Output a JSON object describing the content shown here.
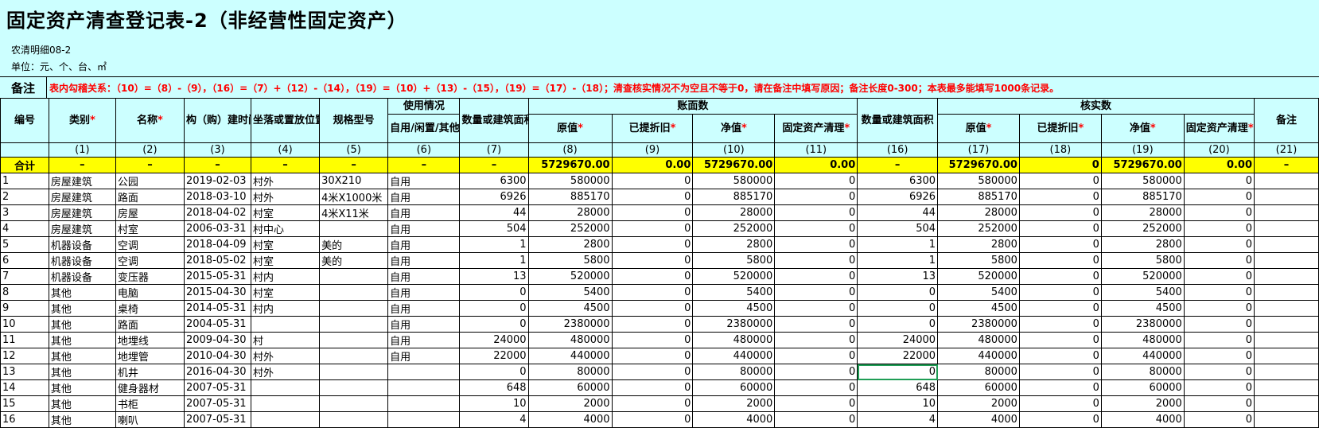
{
  "title": "固定资产清查登记表-2（非经营性固定资产）",
  "subtitle_code": "农清明细08-2",
  "unit_line": "单位：元、个、台、㎡",
  "remark": {
    "label": "备注",
    "text": "表内勾稽关系：（10）=（8）-（9），（16）=（7）+（12）-（14），（19）=（10）+（13）-（15），（19）=（17）-（18）；清查核实情况不为空且不等于0，请在备注中填写原因；备注长度0-300；本表最多能填写1000条记录。"
  },
  "headers": {
    "id": "编号",
    "category": "类别",
    "name": "名称",
    "build_time": "构（购）建时间",
    "location": "坐落或置放位置",
    "spec": "规格型号",
    "usage_group": "使用情况",
    "usage_sub": "自用/闲置/其他",
    "qty_area": "数量或建筑面积",
    "book_group": "账面数",
    "orig_value": "原值",
    "depreciation": "已提折旧",
    "net_value": "净值",
    "fixed_clean": "固定资产清理",
    "verified_group": "核实数",
    "v_qty_area": "数量或建筑面积",
    "v_orig_value": "原值",
    "v_depreciation": "已提折旧",
    "v_net_value": "净值",
    "v_fixed_clean": "固定资产清理",
    "note": "备注",
    "required_mark": "*"
  },
  "col_index": [
    "(1)",
    "(2)",
    "(3)",
    "(4)",
    "(5)",
    "(6)",
    "(7)",
    "(8)",
    "(9)",
    "(10)",
    "(11)",
    "(16)",
    "(17)",
    "(18)",
    "(19)",
    "(20)",
    "(21)"
  ],
  "total": {
    "label": "合计",
    "dash": "–",
    "orig_value": "5729670.00",
    "depreciation": "0.00",
    "net_value": "5729670.00",
    "fixed_clean": "0.00",
    "v_orig_value": "5729670.00",
    "v_depreciation": "0",
    "v_net_value": "5729670.00",
    "v_fixed_clean": "0.00"
  },
  "rows": [
    [
      "1",
      "房屋建筑",
      "公园",
      "2019-02-03",
      "村外",
      "30X210",
      "自用",
      "6300",
      "580000",
      "0",
      "580000",
      "0",
      "6300",
      "580000",
      "0",
      "580000",
      "0",
      ""
    ],
    [
      "2",
      "房屋建筑",
      "路面",
      "2018-03-10",
      "村外",
      "4米X1000米",
      "自用",
      "6926",
      "885170",
      "0",
      "885170",
      "0",
      "6926",
      "885170",
      "0",
      "885170",
      "0",
      ""
    ],
    [
      "3",
      "房屋建筑",
      "房屋",
      "2018-04-02",
      "村室",
      "4米X11米",
      "自用",
      "44",
      "28000",
      "0",
      "28000",
      "0",
      "44",
      "28000",
      "0",
      "28000",
      "0",
      ""
    ],
    [
      "4",
      "房屋建筑",
      "村室",
      "2006-03-31",
      "村中心",
      "",
      "自用",
      "504",
      "252000",
      "0",
      "252000",
      "0",
      "504",
      "252000",
      "0",
      "252000",
      "0",
      ""
    ],
    [
      "5",
      "机器设备",
      "空调",
      "2018-04-09",
      "村室",
      "美的",
      "自用",
      "1",
      "2800",
      "0",
      "2800",
      "0",
      "1",
      "2800",
      "0",
      "2800",
      "0",
      ""
    ],
    [
      "6",
      "机器设备",
      "空调",
      "2018-05-02",
      "村室",
      "美的",
      "自用",
      "1",
      "5800",
      "0",
      "5800",
      "0",
      "1",
      "5800",
      "0",
      "5800",
      "0",
      ""
    ],
    [
      "7",
      "机器设备",
      "变压器",
      "2015-05-31",
      "村内",
      "",
      "自用",
      "13",
      "520000",
      "0",
      "520000",
      "0",
      "13",
      "520000",
      "0",
      "520000",
      "0",
      ""
    ],
    [
      "8",
      "其他",
      "电脑",
      "2015-04-30",
      "村室",
      "",
      "自用",
      "0",
      "5400",
      "0",
      "5400",
      "0",
      "0",
      "5400",
      "0",
      "5400",
      "0",
      ""
    ],
    [
      "9",
      "其他",
      "桌椅",
      "2014-05-31",
      "村内",
      "",
      "自用",
      "0",
      "4500",
      "0",
      "4500",
      "0",
      "0",
      "4500",
      "0",
      "4500",
      "0",
      ""
    ],
    [
      "10",
      "其他",
      "路面",
      "2004-05-31",
      "",
      "",
      "自用",
      "0",
      "2380000",
      "0",
      "2380000",
      "0",
      "0",
      "2380000",
      "0",
      "2380000",
      "0",
      ""
    ],
    [
      "11",
      "其他",
      "地埋线",
      "2009-04-30",
      "村",
      "",
      "自用",
      "24000",
      "480000",
      "0",
      "480000",
      "0",
      "24000",
      "480000",
      "0",
      "480000",
      "0",
      ""
    ],
    [
      "12",
      "其他",
      "地埋管",
      "2010-04-30",
      "村外",
      "",
      "自用",
      "22000",
      "440000",
      "0",
      "440000",
      "0",
      "22000",
      "440000",
      "0",
      "440000",
      "0",
      ""
    ],
    [
      "13",
      "其他",
      "机井",
      "2016-04-30",
      "村外",
      "",
      "",
      "0",
      "80000",
      "0",
      "80000",
      "0",
      "0",
      "80000",
      "0",
      "80000",
      "0",
      ""
    ],
    [
      "14",
      "其他",
      "健身器材",
      "2007-05-31",
      "",
      "",
      "",
      "648",
      "60000",
      "0",
      "60000",
      "0",
      "648",
      "60000",
      "0",
      "60000",
      "0",
      ""
    ],
    [
      "15",
      "其他",
      "书柜",
      "2007-05-31",
      "",
      "",
      "",
      "10",
      "2000",
      "0",
      "2000",
      "0",
      "10",
      "2000",
      "0",
      "2000",
      "0",
      ""
    ],
    [
      "16",
      "其他",
      "喇叭",
      "2007-05-31",
      "",
      "",
      "",
      "4",
      "4000",
      "0",
      "4000",
      "0",
      "4",
      "4000",
      "0",
      "4000",
      "0",
      ""
    ]
  ]
}
